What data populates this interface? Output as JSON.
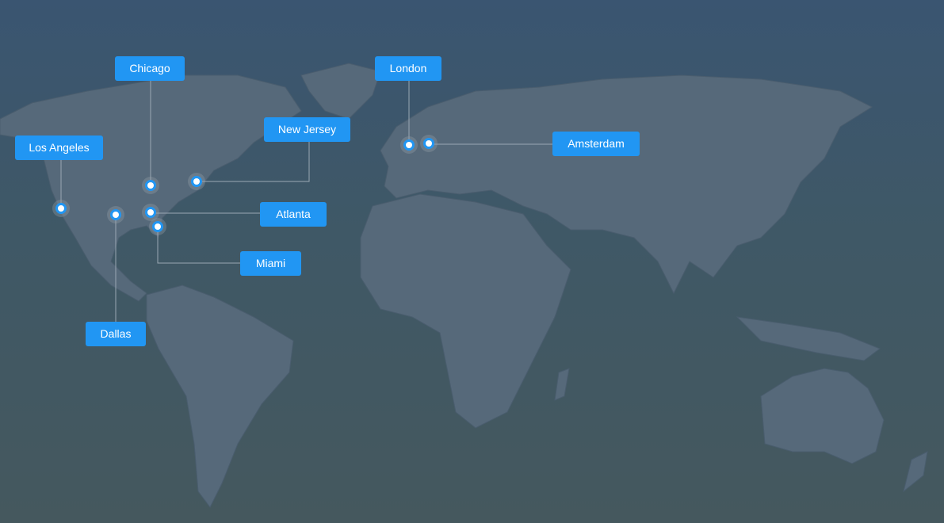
{
  "colors": {
    "label": "#2196f3",
    "land": "#56697a",
    "marker_ring": "#2196f3",
    "marker_dot": "#ffffff",
    "connector": "#9aa8b4"
  },
  "locations": [
    {
      "name": "Chicago",
      "icon": "location-marker-icon"
    },
    {
      "name": "London",
      "icon": "location-marker-icon"
    },
    {
      "name": "New Jersey",
      "icon": "location-marker-icon"
    },
    {
      "name": "Los Angeles",
      "icon": "location-marker-icon"
    },
    {
      "name": "Amsterdam",
      "icon": "location-marker-icon"
    },
    {
      "name": "Atlanta",
      "icon": "location-marker-icon"
    },
    {
      "name": "Miami",
      "icon": "location-marker-icon"
    },
    {
      "name": "Dallas",
      "icon": "location-marker-icon"
    }
  ]
}
